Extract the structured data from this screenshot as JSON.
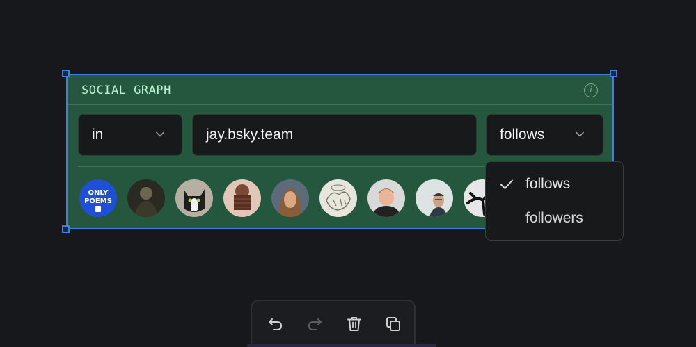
{
  "widget": {
    "title": "SOCIAL GRAPH",
    "info_icon": "info-icon",
    "direction": {
      "value": "in"
    },
    "handle_input": {
      "value": "jay.bsky.team"
    },
    "relation": {
      "value": "follows"
    }
  },
  "dropdown": {
    "options": [
      {
        "label": "follows",
        "selected": true
      },
      {
        "label": "followers",
        "selected": false
      }
    ]
  },
  "avatars": [
    {
      "name": "avatar-only-poems",
      "text": "ONLY POEMS",
      "colors": [
        "#1e4fd6",
        "#ffffff"
      ]
    },
    {
      "name": "avatar-dark-portrait",
      "colors": [
        "#2a2a22",
        "#6b6652"
      ]
    },
    {
      "name": "avatar-cat",
      "colors": [
        "#d9d2c4",
        "#1f1f1f"
      ]
    },
    {
      "name": "avatar-reading-book",
      "colors": [
        "#c58f7c",
        "#5a2f22"
      ]
    },
    {
      "name": "avatar-woman-portrait",
      "colors": [
        "#5c6a7a",
        "#b28a63"
      ]
    },
    {
      "name": "avatar-sketch-drawing",
      "colors": [
        "#e8e6dc",
        "#777766"
      ]
    },
    {
      "name": "avatar-man-smiling",
      "colors": [
        "#d9d9d9",
        "#222222"
      ]
    },
    {
      "name": "avatar-man-glasses",
      "colors": [
        "#dde3e3",
        "#2e3a44"
      ]
    },
    {
      "name": "avatar-tree-silhouette",
      "colors": [
        "#e6e6e6",
        "#111111"
      ]
    }
  ],
  "toolbar": {
    "undo": "undo-icon",
    "redo": "redo-icon",
    "delete": "trash-icon",
    "duplicate": "duplicate-icon"
  },
  "colors": {
    "widget_bg": "#25573e",
    "selection_border": "#3b82e0",
    "title": "#b9f2cf",
    "field_bg": "#18191b",
    "canvas_bg": "#17181b"
  }
}
